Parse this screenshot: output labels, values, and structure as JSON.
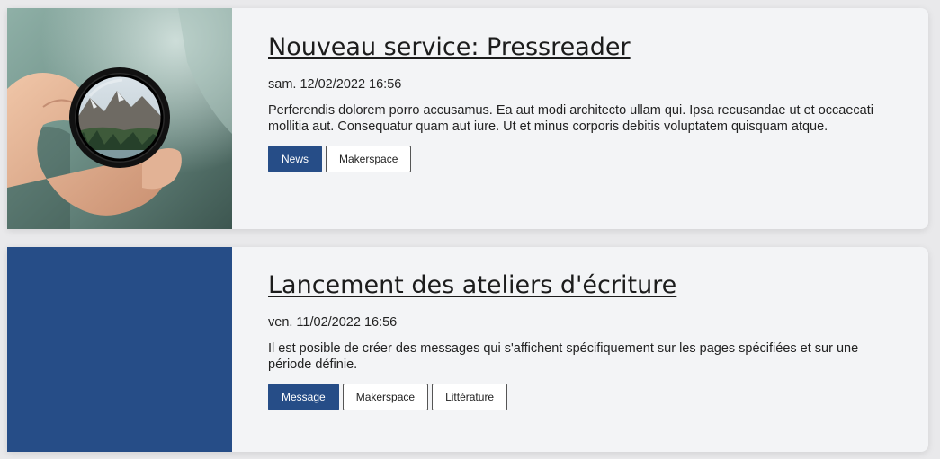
{
  "colors": {
    "accent": "#264d87",
    "card_background": "#f3f4f6",
    "page_background": "#e9e9eb"
  },
  "posts": [
    {
      "title": "Nouveau service: Pressreader",
      "date": "sam. 12/02/2022 16:56",
      "excerpt": "Perferendis dolorem porro accusamus. Ea aut modi architecto ullam qui. Ipsa recusandae ut et occaecati mollitia aut. Consequatur quam aut iure. Ut et minus corporis debitis voluptatem quisquam atque.",
      "thumbnail": "photo-hand-holding-lens-over-mountain-lake",
      "tags": [
        {
          "label": "News",
          "style": "primary"
        },
        {
          "label": "Makerspace",
          "style": "outline"
        }
      ]
    },
    {
      "title": "Lancement des ateliers d'écriture",
      "date": "ven. 11/02/2022 16:56",
      "excerpt": "Il est posible de créer des messages qui s'affichent spécifiquement sur les pages spécifiées et sur une période définie.",
      "thumbnail": "solid-blue-placeholder",
      "tags": [
        {
          "label": "Message",
          "style": "primary"
        },
        {
          "label": "Makerspace",
          "style": "outline"
        },
        {
          "label": "Littérature",
          "style": "outline"
        }
      ]
    }
  ]
}
